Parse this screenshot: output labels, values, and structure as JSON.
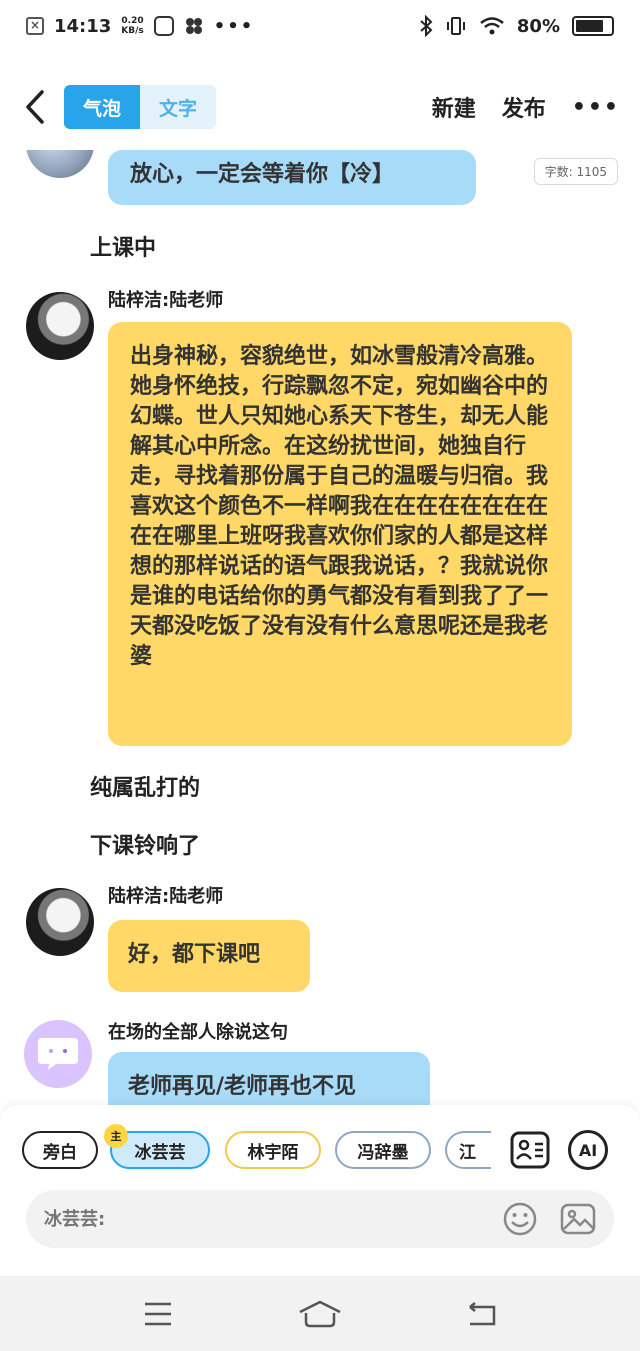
{
  "status_bar": {
    "time": "14:13",
    "speed_value": "0.20",
    "speed_unit": "KB/s",
    "battery": "80%",
    "battery_level": 0.8
  },
  "header": {
    "tabs": [
      {
        "label": "气泡",
        "active": true
      },
      {
        "label": "文字",
        "active": false
      }
    ],
    "new_label": "新建",
    "publish_label": "发布"
  },
  "chat": {
    "word_count": "字数: 1105",
    "messages": [
      {
        "type": "bubble",
        "color": "blue",
        "text": "放心，一定会等着你【冷】"
      },
      {
        "type": "narration",
        "text": "上课中"
      },
      {
        "type": "bubble",
        "color": "yellow",
        "speaker": "陆梓洁:陆老师",
        "text": "出身神秘，容貌绝世，如冰雪般清冷高雅。她身怀绝技，行踪飘忽不定，宛如幽谷中的幻蝶。世人只知她心系天下苍生，却无人能解其心中所念。在这纷扰世间，她独自行走，寻找着那份属于自己的温暖与归宿。我喜欢这个颜色不一样啊我在在在在在在在在在在哪里上班呀我喜欢你们家的人都是这样想的那样说话的语气跟我说话，？我就说你是谁的电话给你的勇气都没有看到我了了一天都没吃饭了没有没有什么意思呢还是我老婆"
      },
      {
        "type": "narration",
        "text": "纯属乱打的"
      },
      {
        "type": "narration",
        "text": "下课铃响了"
      },
      {
        "type": "bubble",
        "color": "yellow",
        "speaker": "陆梓洁:陆老师",
        "text": "好，都下课吧"
      },
      {
        "type": "bubble",
        "color": "blue",
        "speaker": "在场的全部人除说这句",
        "text": "老师再见/老师再也不见"
      }
    ]
  },
  "composer": {
    "characters": [
      {
        "label": "旁白"
      },
      {
        "label": "冰芸芸",
        "selected": true,
        "badge": "主"
      },
      {
        "label": "林宇陌"
      },
      {
        "label": "冯辞墨"
      },
      {
        "label": "江"
      }
    ],
    "ai_label": "AI",
    "input_prefix": "冰芸芸:"
  },
  "colors": {
    "accent": "#27a4ea",
    "blue_bubble": "#a8dbf8",
    "yellow_bubble": "#ffd868"
  }
}
